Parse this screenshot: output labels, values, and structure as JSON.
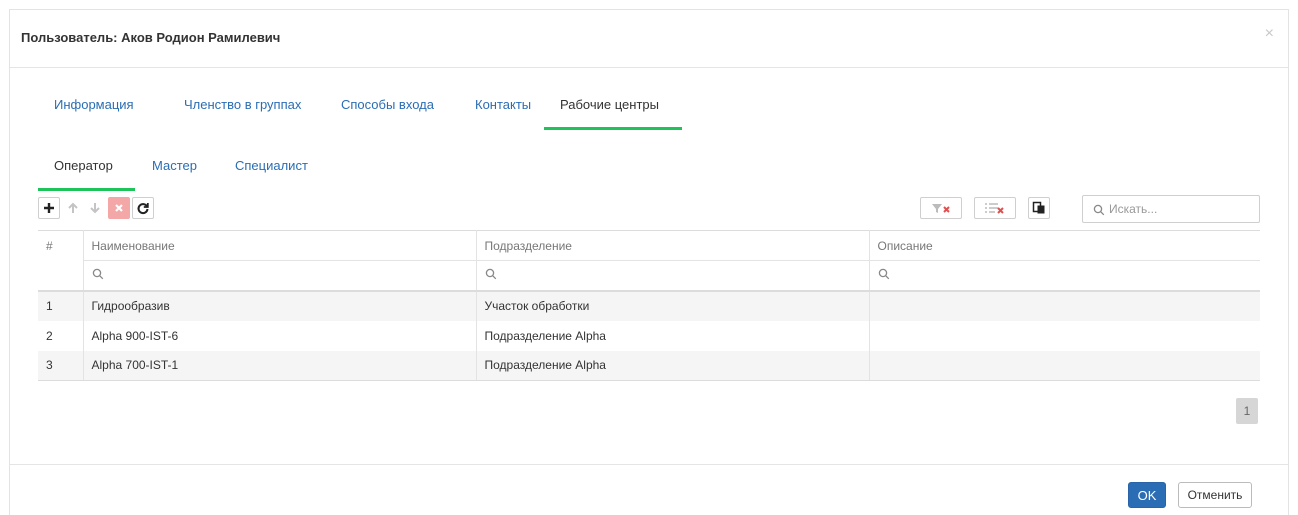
{
  "dialog": {
    "title": "Пользователь: Аков Родион Рамилевич",
    "close_glyph": "×"
  },
  "tabs": [
    {
      "label": "Информация",
      "active": false
    },
    {
      "label": "Членство в группах",
      "active": false
    },
    {
      "label": "Способы входа",
      "active": false
    },
    {
      "label": "Контакты",
      "active": false
    },
    {
      "label": "Рабочие центры",
      "active": true
    }
  ],
  "subtabs": [
    {
      "label": "Оператор",
      "active": true
    },
    {
      "label": "Мастер",
      "active": false
    },
    {
      "label": "Специалист",
      "active": false
    }
  ],
  "toolbar": {
    "icons": [
      "plus-icon",
      "arrow-up-icon",
      "arrow-down-icon",
      "delete-icon",
      "refresh-icon",
      "clear-filter-icon",
      "clear-sort-icon",
      "copy-icon"
    ],
    "search_placeholder": "Искать..."
  },
  "grid": {
    "columns": [
      "#",
      "Наименование",
      "Подразделение",
      "Описание"
    ],
    "rows": [
      {
        "num": "1",
        "name": "Гидрообразив",
        "department": "Участок обработки",
        "description": ""
      },
      {
        "num": "2",
        "name": "Alpha 900-IST-6",
        "department": "Подразделение Alpha",
        "description": ""
      },
      {
        "num": "3",
        "name": "Alpha 700-IST-1",
        "department": "Подразделение Alpha",
        "description": ""
      }
    ]
  },
  "pager": {
    "current_page": "1"
  },
  "footer": {
    "ok_label": "OK",
    "cancel_label": "Отменить"
  },
  "colors": {
    "accent": "#2a6db5",
    "active_underline": "#1ec35a",
    "danger": "#f3a7a7"
  }
}
